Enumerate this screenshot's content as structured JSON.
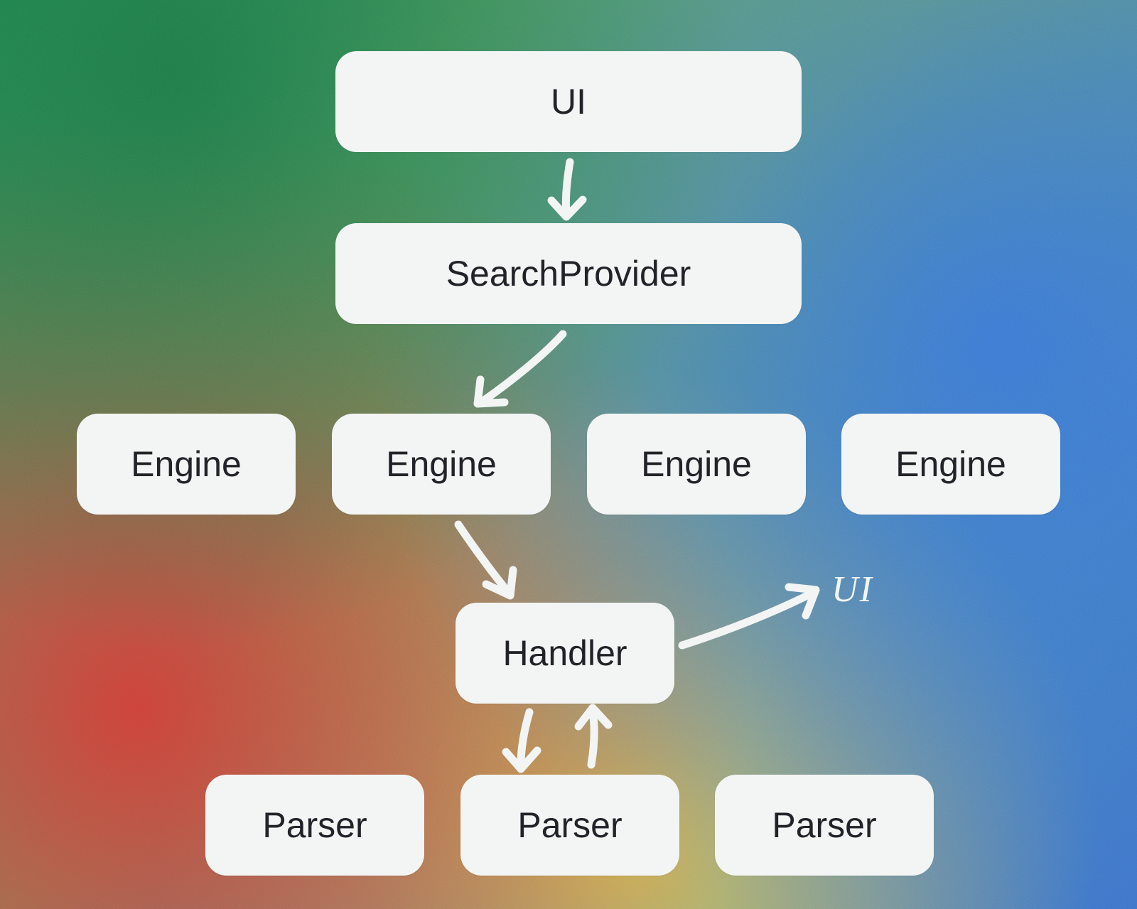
{
  "nodes": {
    "ui": "UI",
    "searchProvider": "SearchProvider",
    "engine1": "Engine",
    "engine2": "Engine",
    "engine3": "Engine",
    "engine4": "Engine",
    "handler": "Handler",
    "parser1": "Parser",
    "parser2": "Parser",
    "parser3": "Parser"
  },
  "annotations": {
    "handlerToUiLabel": "UI"
  },
  "edges": [
    {
      "from": "ui",
      "to": "searchProvider"
    },
    {
      "from": "searchProvider",
      "to": "engine2"
    },
    {
      "from": "engine2",
      "to": "handler"
    },
    {
      "from": "handler",
      "to": "parser2"
    },
    {
      "from": "parser2",
      "to": "handler"
    },
    {
      "from": "handler",
      "to": "annotations.handlerToUiLabel"
    }
  ]
}
